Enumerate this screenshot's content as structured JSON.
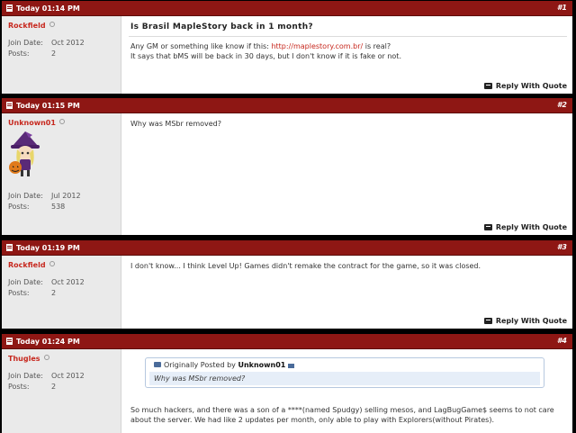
{
  "posts": [
    {
      "date": "Today 01:14 PM",
      "number": "#1",
      "username": "Rockfield",
      "join_label": "Join Date:",
      "join_value": "Oct 2012",
      "posts_label": "Posts:",
      "posts_value": "2",
      "title": "Is Brasil MapleStory back in 1 month?",
      "line1_pre": "Any GM or something like know if this: ",
      "link": "http://maplestory.com.br/",
      "line1_post": " is real?",
      "line2": "It says that bMS will be back in 30 days, but I don't know if it is fake or not.",
      "reply": "Reply With Quote"
    },
    {
      "date": "Today 01:15 PM",
      "number": "#2",
      "username": "Unknown01",
      "join_label": "Join Date:",
      "join_value": "Jul 2012",
      "posts_label": "Posts:",
      "posts_value": "538",
      "text": "Why was MSbr removed?",
      "reply": "Reply With Quote"
    },
    {
      "date": "Today 01:19 PM",
      "number": "#3",
      "username": "Rockfield",
      "join_label": "Join Date:",
      "join_value": "Oct 2012",
      "posts_label": "Posts:",
      "posts_value": "2",
      "text": "I don't know... I think Level Up! Games didn't remake the contract for the game, so it was closed.",
      "reply": "Reply With Quote"
    },
    {
      "date": "Today 01:24 PM",
      "number": "#4",
      "username": "Thugles",
      "join_label": "Join Date:",
      "join_value": "Oct 2012",
      "posts_label": "Posts:",
      "posts_value": "2",
      "quote_prefix": "Originally Posted by ",
      "quote_author": "Unknown01",
      "quote_text": "Why was MSbr removed?",
      "text": "So much hackers, and there was a son of a ****(named Spudgy) selling mesos, and LagBugGame$ seems to not care about the server. We had like 2 updates per month, only able to play with Explorers(without Pirates)."
    }
  ],
  "colors": {
    "header": "#8e1714",
    "username": "#c7281e",
    "sidebar": "#eaeaea"
  },
  "icons": [
    "post-document-icon",
    "online-status-icon",
    "reply-quote-icon",
    "quote-icon",
    "view-post-arrow-icon"
  ]
}
